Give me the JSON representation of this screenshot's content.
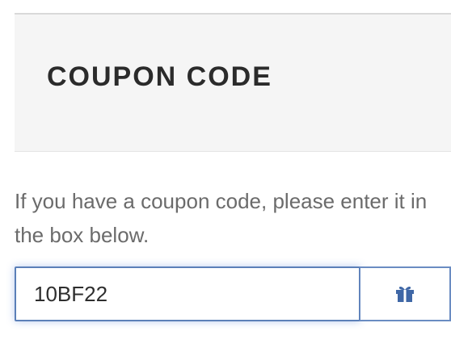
{
  "coupon": {
    "title": "COUPON CODE",
    "description": "If you have a coupon code, please enter it in the box below.",
    "input_value": "10BF22",
    "apply_icon": "gift-icon"
  },
  "colors": {
    "header_background": "#f5f5f5",
    "title_text": "#2b2b2b",
    "description_text": "#6b6b6b",
    "input_border": "#5b7fb8",
    "icon": "#3f67a6"
  }
}
